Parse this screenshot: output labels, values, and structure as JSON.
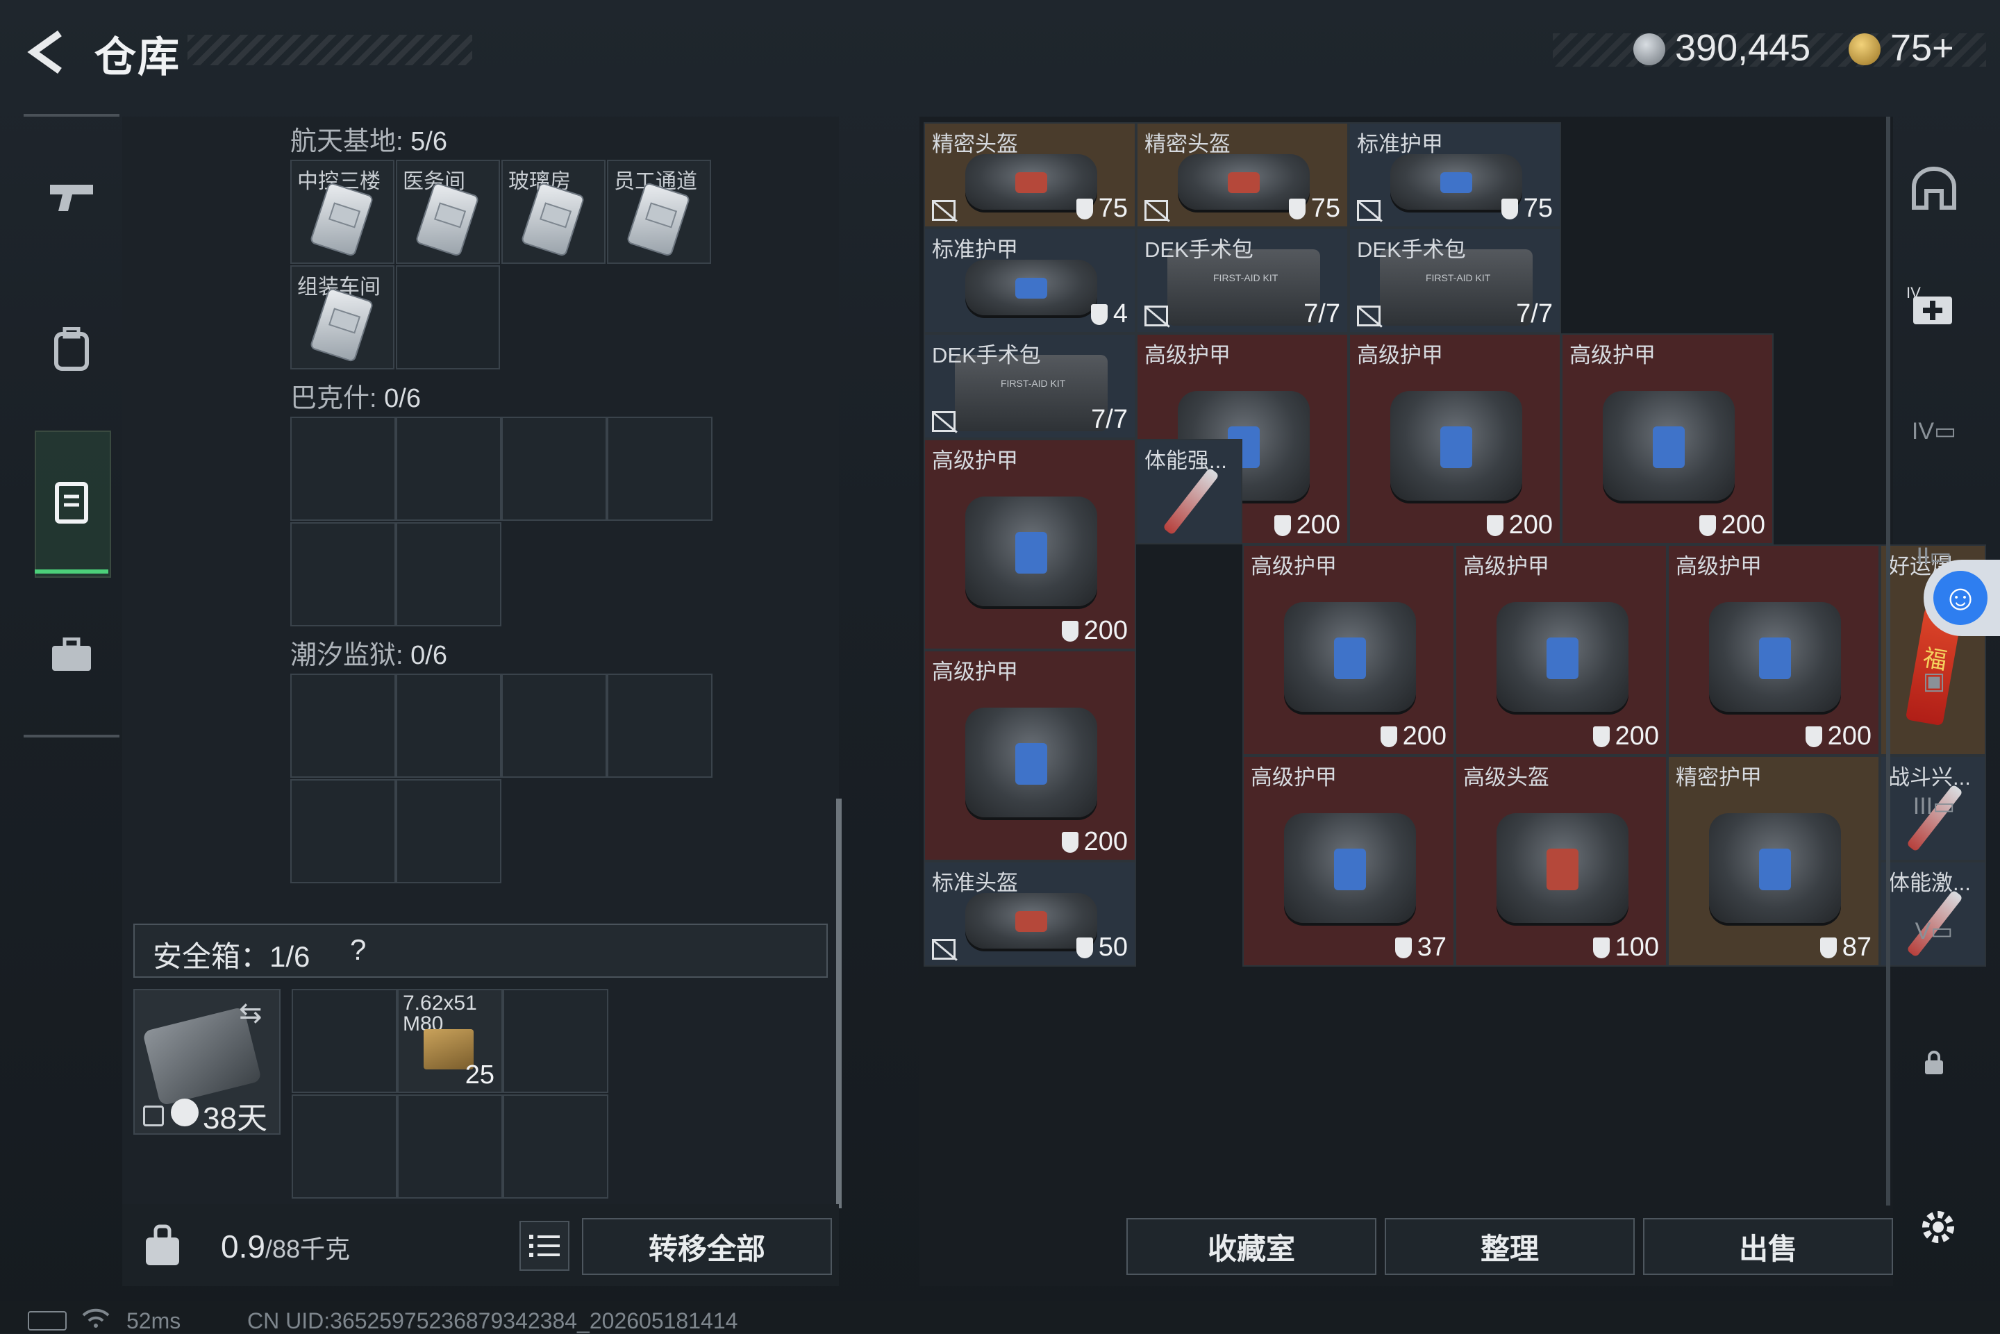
{
  "header": {
    "title": "仓库",
    "currency1": "390,445",
    "currency2": "75+"
  },
  "left_nav": [
    "pistol-icon",
    "backpack-icon",
    "vest-icon",
    "case-icon"
  ],
  "sections": [
    {
      "label": "航天基地",
      "count": "5/6",
      "slots": [
        "中控三楼",
        "医务间",
        "玻璃房",
        "员工通道",
        "组装车间"
      ]
    },
    {
      "label": "巴克什",
      "count": "0/6"
    },
    {
      "label": "潮汐监狱",
      "count": "0/6"
    }
  ],
  "safe_box": {
    "label": "安全箱：",
    "count": "1/6",
    "help": "?",
    "days": "38天",
    "ammo_name": "7.62x51 M80",
    "ammo_count": "25"
  },
  "bottom": {
    "weight": "0.9",
    "weight_max": "/88千克",
    "transfer_all": "转移全部"
  },
  "items": [
    {
      "name": "精密头盔",
      "dur": "75"
    },
    {
      "name": "精密头盔",
      "dur": "75"
    },
    {
      "name": "标准护甲",
      "dur": "75"
    },
    {
      "name": "标准护甲",
      "dur": "4"
    },
    {
      "name": "DEK手术包",
      "dur": "7/7"
    },
    {
      "name": "DEK手术包",
      "dur": "7/7"
    },
    {
      "name": "DEK手术包",
      "dur": "7/7"
    },
    {
      "name": "高级护甲",
      "dur": "200"
    },
    {
      "name": "高级护甲",
      "dur": "200"
    },
    {
      "name": "高级护甲",
      "dur": "200"
    },
    {
      "name": "高级护甲",
      "dur": "200"
    },
    {
      "name": "体能强..."
    },
    {
      "name": "高级护甲",
      "dur": "200"
    },
    {
      "name": "高级护甲",
      "dur": "200"
    },
    {
      "name": "高级护甲",
      "dur": "200"
    },
    {
      "name": "好运爆..."
    },
    {
      "name": "高级护甲",
      "dur": "200"
    },
    {
      "name": "高级护甲",
      "dur": "37"
    },
    {
      "name": "高级头盔",
      "dur": "100"
    },
    {
      "name": "精密护甲",
      "dur": "87"
    },
    {
      "name": "战斗兴..."
    },
    {
      "name": "标准头盔",
      "dur": "50"
    },
    {
      "name": "体能激..."
    }
  ],
  "buttons": {
    "collection": "收藏室",
    "organize": "整理",
    "sell": "出售"
  },
  "status": {
    "ping": "52ms",
    "uid": "CN UID:3652597523687934238​4_202605181414"
  }
}
